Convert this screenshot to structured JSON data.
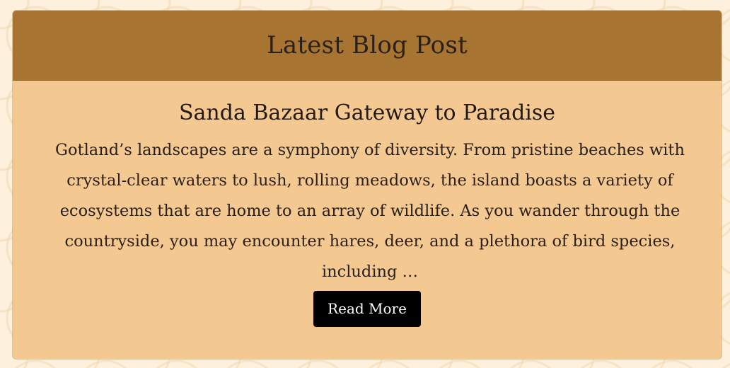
{
  "header": {
    "title": "Latest Blog Post"
  },
  "post": {
    "title": "Sanda Bazaar Gateway to Paradise",
    "excerpt": "Gotland’s landscapes are a symphony of diversity. From pristine beaches with crystal-clear waters to lush, rolling meadows, the island boasts a variety of ecosystems that are home to an array of wildlife. As you wander through the countryside, you may encounter hares, deer, and a plethora of bird species, including …",
    "read_more_label": "Read More"
  },
  "colors": {
    "page_background": "#fdf0dc",
    "header_background": "#a87431",
    "body_background": "#f4c891",
    "button_background": "#000000",
    "button_text": "#ffffff"
  }
}
